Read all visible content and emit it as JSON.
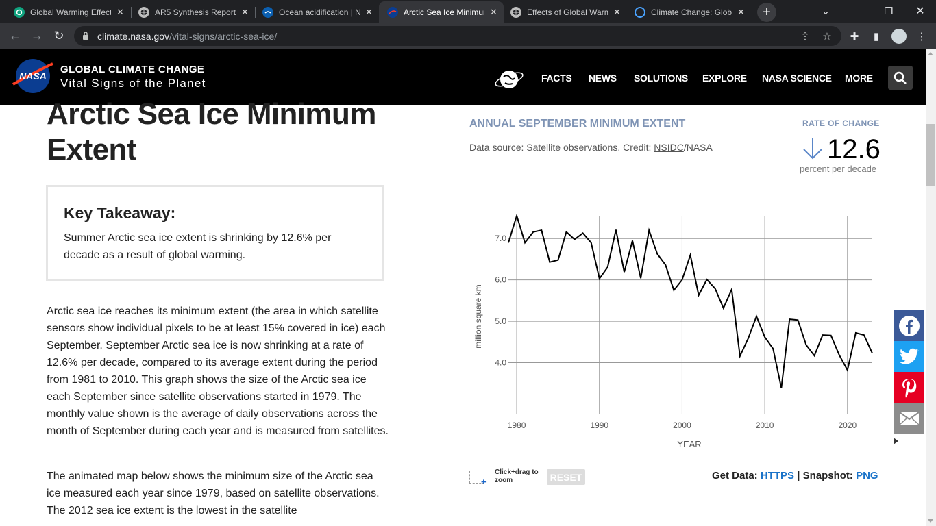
{
  "browser": {
    "tabs": [
      {
        "title": "Global Warming Effect",
        "icon": "chatgpt-icon",
        "active": false
      },
      {
        "title": "AR5 Synthesis Report",
        "icon": "globe-icon",
        "active": false
      },
      {
        "title": "Ocean acidification | N",
        "icon": "noaa-icon",
        "active": false
      },
      {
        "title": "Arctic Sea Ice Minimum",
        "icon": "nasa-icon",
        "active": true
      },
      {
        "title": "Effects of Global Warm",
        "icon": "globe-icon",
        "active": false
      },
      {
        "title": "Climate Change: Globa",
        "icon": "swirl-icon",
        "active": false
      }
    ],
    "url_host": "climate.nasa.gov",
    "url_path": "/vital-signs/arctic-sea-ice/"
  },
  "site": {
    "brand_title": "GLOBAL CLIMATE CHANGE",
    "brand_subtitle": "Vital Signs of the Planet",
    "logo_text": "NASA",
    "nav": [
      "FACTS",
      "NEWS",
      "SOLUTIONS",
      "EXPLORE",
      "NASA SCIENCE",
      "MORE"
    ]
  },
  "article": {
    "title_line1": "Arctic Sea Ice Minimum",
    "title_line2": "Extent",
    "takeaway_heading": "Key Takeaway:",
    "takeaway_text": "Summer Arctic sea ice extent is shrinking by 12.6% per decade as a result of global warming.",
    "paragraph1": "Arctic sea ice reaches its minimum extent (the area in which satellite sensors show individual pixels to be at least 15% covered in ice) each September. September Arctic sea ice is now shrinking at a rate of 12.6% per decade, compared to its average extent during the period from 1981 to 2010. This graph shows the size of the Arctic sea ice each September since satellite observations started in 1979. The monthly value shown is the average of daily observations across the month of September during each year and is measured from satellites.",
    "paragraph2": "The animated map below shows the minimum size of the Arctic sea ice measured each year since 1979, based on satellite observations. The 2012 sea ice extent is the lowest in the satellite"
  },
  "panel": {
    "heading": "ANNUAL SEPTEMBER MINIMUM EXTENT",
    "source_prefix": "Data source: Satellite observations. Credit: ",
    "source_link": "NSIDC",
    "source_suffix": "/NASA",
    "rate_label": "RATE OF CHANGE",
    "rate_value": "12.6",
    "rate_unit": "percent per decade",
    "zoom_hint": "Click+drag to zoom",
    "reset_label": "RESET",
    "get_data_label": "Get Data:",
    "get_data_link": "HTTPS",
    "separator": "|",
    "snapshot_label": "Snapshot:",
    "snapshot_link": "PNG"
  },
  "share": [
    {
      "name": "facebook",
      "color": "#3b5998"
    },
    {
      "name": "twitter",
      "color": "#1da1f2"
    },
    {
      "name": "pinterest",
      "color": "#e60023"
    },
    {
      "name": "email",
      "color": "#8c8c8c"
    }
  ],
  "chart_data": {
    "type": "line",
    "title": "ANNUAL SEPTEMBER MINIMUM EXTENT",
    "xlabel": "YEAR",
    "ylabel": "million square km",
    "xlim": [
      1979,
      2023
    ],
    "ylim": [
      3.0,
      7.55
    ],
    "x_ticks": [
      1980,
      1990,
      2000,
      2010,
      2020
    ],
    "y_ticks": [
      4.0,
      5.0,
      6.0,
      7.0
    ],
    "y_tick_labels": [
      "4.0",
      "5.0",
      "6.0",
      "7.0"
    ],
    "grid": true,
    "series": [
      {
        "color": "#000000",
        "x": [
          1979,
          1980,
          1981,
          1982,
          1983,
          1984,
          1985,
          1986,
          1987,
          1988,
          1989,
          1990,
          1991,
          1992,
          1993,
          1994,
          1995,
          1996,
          1997,
          1998,
          1999,
          2000,
          2001,
          2002,
          2003,
          2004,
          2005,
          2006,
          2007,
          2008,
          2009,
          2010,
          2011,
          2012,
          2013,
          2014,
          2015,
          2016,
          2017,
          2018,
          2019,
          2020,
          2021,
          2022,
          2023
        ],
        "values": [
          6.9,
          7.55,
          6.9,
          7.16,
          7.2,
          6.43,
          6.48,
          7.16,
          6.98,
          7.13,
          6.9,
          6.03,
          6.31,
          7.21,
          6.19,
          6.95,
          6.04,
          7.2,
          6.63,
          6.36,
          5.75,
          6.0,
          6.6,
          5.63,
          6.01,
          5.79,
          5.32,
          5.77,
          4.16,
          4.59,
          5.12,
          4.62,
          4.34,
          3.39,
          5.05,
          5.03,
          4.43,
          4.17,
          4.67,
          4.66,
          4.19,
          3.82,
          4.72,
          4.67,
          4.23
        ]
      }
    ]
  }
}
